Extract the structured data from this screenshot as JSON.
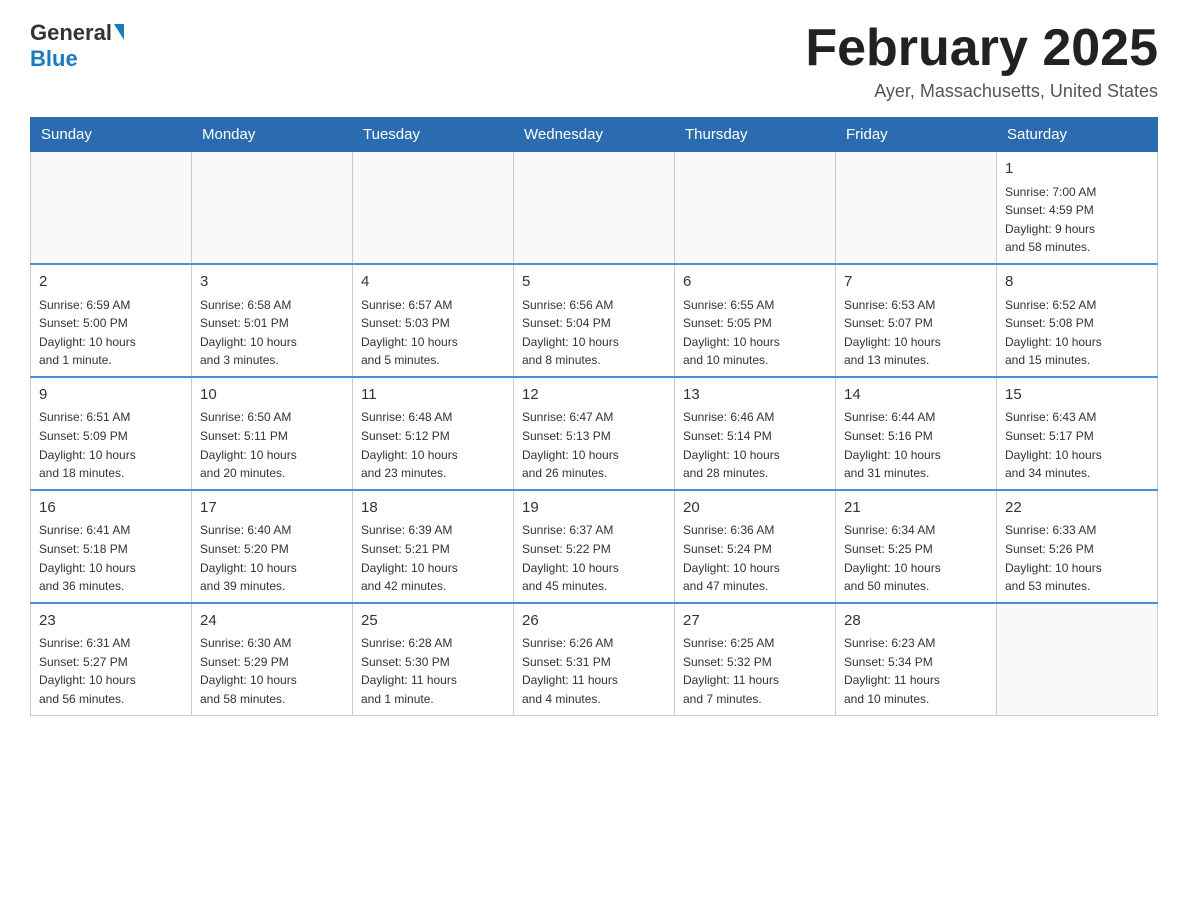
{
  "logo": {
    "general": "General",
    "blue": "Blue"
  },
  "title": "February 2025",
  "subtitle": "Ayer, Massachusetts, United States",
  "weekdays": [
    "Sunday",
    "Monday",
    "Tuesday",
    "Wednesday",
    "Thursday",
    "Friday",
    "Saturday"
  ],
  "weeks": [
    [
      {
        "day": "",
        "info": ""
      },
      {
        "day": "",
        "info": ""
      },
      {
        "day": "",
        "info": ""
      },
      {
        "day": "",
        "info": ""
      },
      {
        "day": "",
        "info": ""
      },
      {
        "day": "",
        "info": ""
      },
      {
        "day": "1",
        "info": "Sunrise: 7:00 AM\nSunset: 4:59 PM\nDaylight: 9 hours\nand 58 minutes."
      }
    ],
    [
      {
        "day": "2",
        "info": "Sunrise: 6:59 AM\nSunset: 5:00 PM\nDaylight: 10 hours\nand 1 minute."
      },
      {
        "day": "3",
        "info": "Sunrise: 6:58 AM\nSunset: 5:01 PM\nDaylight: 10 hours\nand 3 minutes."
      },
      {
        "day": "4",
        "info": "Sunrise: 6:57 AM\nSunset: 5:03 PM\nDaylight: 10 hours\nand 5 minutes."
      },
      {
        "day": "5",
        "info": "Sunrise: 6:56 AM\nSunset: 5:04 PM\nDaylight: 10 hours\nand 8 minutes."
      },
      {
        "day": "6",
        "info": "Sunrise: 6:55 AM\nSunset: 5:05 PM\nDaylight: 10 hours\nand 10 minutes."
      },
      {
        "day": "7",
        "info": "Sunrise: 6:53 AM\nSunset: 5:07 PM\nDaylight: 10 hours\nand 13 minutes."
      },
      {
        "day": "8",
        "info": "Sunrise: 6:52 AM\nSunset: 5:08 PM\nDaylight: 10 hours\nand 15 minutes."
      }
    ],
    [
      {
        "day": "9",
        "info": "Sunrise: 6:51 AM\nSunset: 5:09 PM\nDaylight: 10 hours\nand 18 minutes."
      },
      {
        "day": "10",
        "info": "Sunrise: 6:50 AM\nSunset: 5:11 PM\nDaylight: 10 hours\nand 20 minutes."
      },
      {
        "day": "11",
        "info": "Sunrise: 6:48 AM\nSunset: 5:12 PM\nDaylight: 10 hours\nand 23 minutes."
      },
      {
        "day": "12",
        "info": "Sunrise: 6:47 AM\nSunset: 5:13 PM\nDaylight: 10 hours\nand 26 minutes."
      },
      {
        "day": "13",
        "info": "Sunrise: 6:46 AM\nSunset: 5:14 PM\nDaylight: 10 hours\nand 28 minutes."
      },
      {
        "day": "14",
        "info": "Sunrise: 6:44 AM\nSunset: 5:16 PM\nDaylight: 10 hours\nand 31 minutes."
      },
      {
        "day": "15",
        "info": "Sunrise: 6:43 AM\nSunset: 5:17 PM\nDaylight: 10 hours\nand 34 minutes."
      }
    ],
    [
      {
        "day": "16",
        "info": "Sunrise: 6:41 AM\nSunset: 5:18 PM\nDaylight: 10 hours\nand 36 minutes."
      },
      {
        "day": "17",
        "info": "Sunrise: 6:40 AM\nSunset: 5:20 PM\nDaylight: 10 hours\nand 39 minutes."
      },
      {
        "day": "18",
        "info": "Sunrise: 6:39 AM\nSunset: 5:21 PM\nDaylight: 10 hours\nand 42 minutes."
      },
      {
        "day": "19",
        "info": "Sunrise: 6:37 AM\nSunset: 5:22 PM\nDaylight: 10 hours\nand 45 minutes."
      },
      {
        "day": "20",
        "info": "Sunrise: 6:36 AM\nSunset: 5:24 PM\nDaylight: 10 hours\nand 47 minutes."
      },
      {
        "day": "21",
        "info": "Sunrise: 6:34 AM\nSunset: 5:25 PM\nDaylight: 10 hours\nand 50 minutes."
      },
      {
        "day": "22",
        "info": "Sunrise: 6:33 AM\nSunset: 5:26 PM\nDaylight: 10 hours\nand 53 minutes."
      }
    ],
    [
      {
        "day": "23",
        "info": "Sunrise: 6:31 AM\nSunset: 5:27 PM\nDaylight: 10 hours\nand 56 minutes."
      },
      {
        "day": "24",
        "info": "Sunrise: 6:30 AM\nSunset: 5:29 PM\nDaylight: 10 hours\nand 58 minutes."
      },
      {
        "day": "25",
        "info": "Sunrise: 6:28 AM\nSunset: 5:30 PM\nDaylight: 11 hours\nand 1 minute."
      },
      {
        "day": "26",
        "info": "Sunrise: 6:26 AM\nSunset: 5:31 PM\nDaylight: 11 hours\nand 4 minutes."
      },
      {
        "day": "27",
        "info": "Sunrise: 6:25 AM\nSunset: 5:32 PM\nDaylight: 11 hours\nand 7 minutes."
      },
      {
        "day": "28",
        "info": "Sunrise: 6:23 AM\nSunset: 5:34 PM\nDaylight: 11 hours\nand 10 minutes."
      },
      {
        "day": "",
        "info": ""
      }
    ]
  ]
}
